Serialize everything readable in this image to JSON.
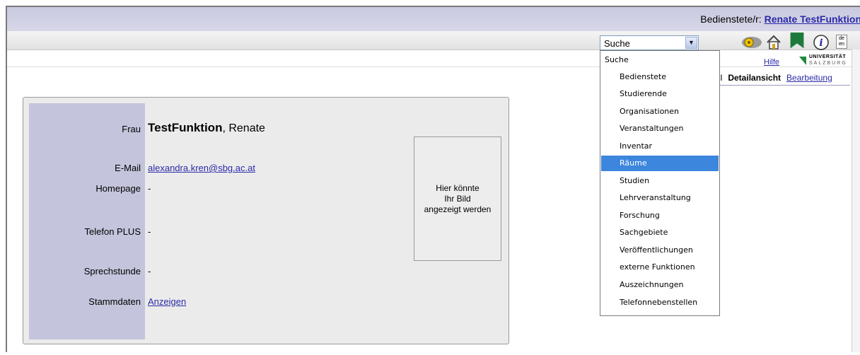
{
  "header": {
    "user_prefix": "Bedienstete/r:",
    "user_name": "Renate TestFunktion"
  },
  "toolbar": {
    "search_select_value": "Suche",
    "icons": [
      "key-icon",
      "home-icon",
      "bookmark-icon",
      "info-icon",
      "language-icon"
    ],
    "language_label": "de en"
  },
  "links": {
    "hilfe": "Hilfe"
  },
  "logo": {
    "line1": "UNIVERSITÄT",
    "line2": "SALZBURG"
  },
  "views": {
    "partial": "hl",
    "active": "Detailansicht",
    "edit": "Bearbeitung"
  },
  "person": {
    "salutation": "Frau",
    "last_name": "TestFunktion",
    "first_name": ", Renate",
    "email_label": "E-Mail",
    "email": "alexandra.kren@sbg.ac.at",
    "homepage_label": "Homepage",
    "homepage": "-",
    "phone_label": "Telefon  PLUS",
    "phone": "-",
    "office_hours_label": "Sprechstunde",
    "office_hours": "-",
    "master_data_label": "Stammdaten",
    "master_data_link": "Anzeigen"
  },
  "photo": {
    "placeholder_line1": "Hier könnte",
    "placeholder_line2": "Ihr Bild",
    "placeholder_line3": "angezeigt werden"
  },
  "dropdown": {
    "header": "Suche",
    "items": [
      "Bedienstete",
      "Studierende",
      "Organisationen",
      "Veranstaltungen",
      "Inventar",
      "Räume",
      "Studien",
      "Lehrveranstaltung",
      "Forschung",
      "Sachgebiete",
      "Veröffentlichungen",
      "externe Funktionen",
      "Auszeichnungen",
      "Telefonnebenstellen"
    ],
    "selected": "Räume"
  },
  "colors": {
    "topbar": "#c9c9e0",
    "label_column": "#c4c4dc",
    "link": "#2a2aa8",
    "dropdown_selection": "#3d86de"
  }
}
